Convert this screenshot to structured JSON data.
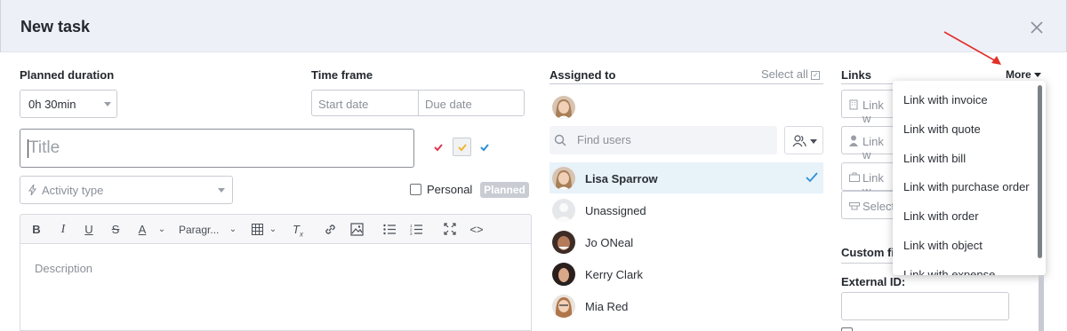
{
  "dialog": {
    "title": "New task"
  },
  "planned_duration": {
    "label": "Planned duration",
    "value": "0h 30min"
  },
  "time_frame": {
    "label": "Time frame",
    "start_placeholder": "Start date",
    "due_placeholder": "Due date"
  },
  "title_field": {
    "placeholder": "Title"
  },
  "activity_type": {
    "placeholder": "Activity type"
  },
  "personal": {
    "label": "Personal",
    "checked": false
  },
  "planned_badge": "Planned",
  "editor": {
    "paragraph_label": "Paragr...",
    "description_placeholder": "Description",
    "tools": [
      "bold-icon",
      "italic-icon",
      "underline-icon",
      "strikethrough-icon",
      "font-color-icon",
      "paragraph-format",
      "table-icon",
      "clear-format-icon",
      "link-icon",
      "image-icon",
      "bullet-list-icon",
      "numbered-list-icon",
      "fullscreen-icon",
      "code-view-icon"
    ]
  },
  "assigned": {
    "label": "Assigned to",
    "select_all": "Select all",
    "find_placeholder": "Find users",
    "users": [
      {
        "name": "Lisa Sparrow",
        "selected": true
      },
      {
        "name": "Unassigned",
        "selected": false
      },
      {
        "name": "Jo ONeal",
        "selected": false
      },
      {
        "name": "Kerry Clark",
        "selected": false
      },
      {
        "name": "Mia Red",
        "selected": false
      }
    ]
  },
  "links": {
    "label": "Links",
    "more_label": "More",
    "fields": [
      "Link w",
      "Link w",
      "Link w",
      "Select"
    ],
    "menu": [
      "Link with invoice",
      "Link with quote",
      "Link with bill",
      "Link with purchase order",
      "Link with order",
      "Link with object",
      "Link with expense"
    ]
  },
  "custom_fields": {
    "label": "Custom fi",
    "external_id_label": "External ID:"
  },
  "colors": {
    "accent": "#2a8fd6",
    "red_check": "#e0344f",
    "yellow_check": "#f2b52e",
    "blue_check": "#2a8fd6",
    "annotation_arrow": "#e0302a"
  }
}
